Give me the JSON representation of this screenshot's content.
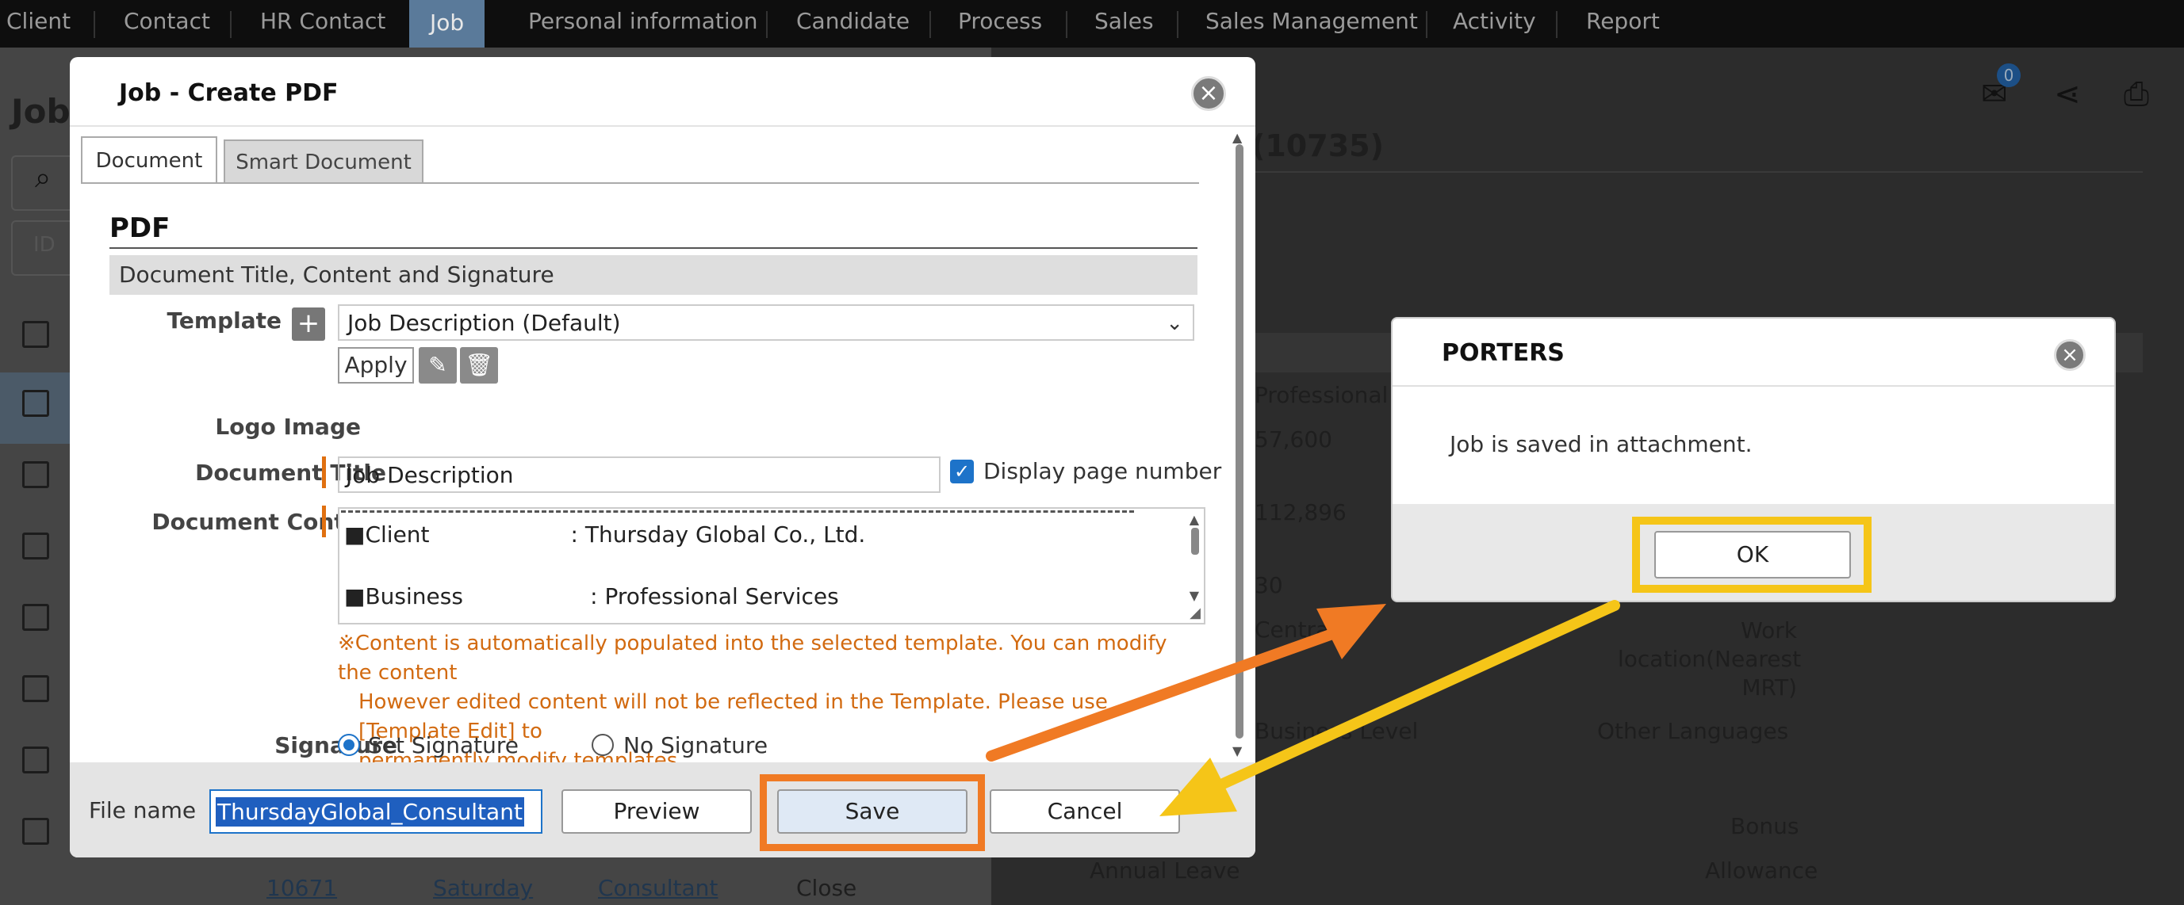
{
  "nav": {
    "items": [
      "Client",
      "Contact",
      "HR Contact",
      "Job",
      "Personal information",
      "Candidate",
      "Process",
      "Sales",
      "Sales Management",
      "Activity",
      "Report"
    ],
    "active": "Job"
  },
  "background": {
    "page_title_fragment": "Job",
    "search_placeholder_fragment": "ID",
    "record_title_fragment": "(10735)",
    "mail_badge": "0",
    "field_values": [
      "Professional S",
      "57,600",
      "112,896",
      "30",
      "Central",
      "Business Level"
    ],
    "right_labels": [
      "Work location(Nearest MRT)",
      "Other Languages",
      "Bonus",
      "Allowance"
    ],
    "annual_leave_label": "Annual Leave",
    "bottom_row": {
      "id": "10671",
      "client": "Saturday",
      "position": "Consultant",
      "status": "Close"
    }
  },
  "pdf_modal": {
    "title": "Job - Create PDF",
    "tabs": [
      "Document",
      "Smart Document"
    ],
    "heading": "PDF",
    "section": "Document Title, Content and Signature",
    "template_label": "Template",
    "template_value": "Job Description (Default)",
    "apply_label": "Apply",
    "logo_label": "Logo Image",
    "doc_title_label": "Document Title",
    "doc_title_value": "Job Description",
    "page_number_label": "Display page number",
    "page_number_checked": true,
    "doc_content_label": "Document Content",
    "content_lines": [
      "■Client                    : Thursday Global Co., Ltd.",
      "■Business                  : Professional Services"
    ],
    "note_line1": "※Content is automatically populated into the selected template. You can modify the content",
    "note_line2": "However edited content will not be reflected in the Template. Please use [Template Edit] to",
    "note_line3": "permanently modify templates.",
    "signature_label": "Signature",
    "signature_options": [
      "Set Signature",
      "No Signature"
    ],
    "signature_selected": "Set Signature",
    "filename_label": "File name",
    "filename_value": "ThursdayGlobal_Consultant",
    "preview_label": "Preview",
    "save_label": "Save",
    "cancel_label": "Cancel"
  },
  "porters_dialog": {
    "title": "PORTERS",
    "message": "Job is saved in attachment.",
    "ok_label": "OK"
  },
  "annotation_colors": {
    "orange": "#f07a24",
    "yellow": "#f5c518"
  }
}
